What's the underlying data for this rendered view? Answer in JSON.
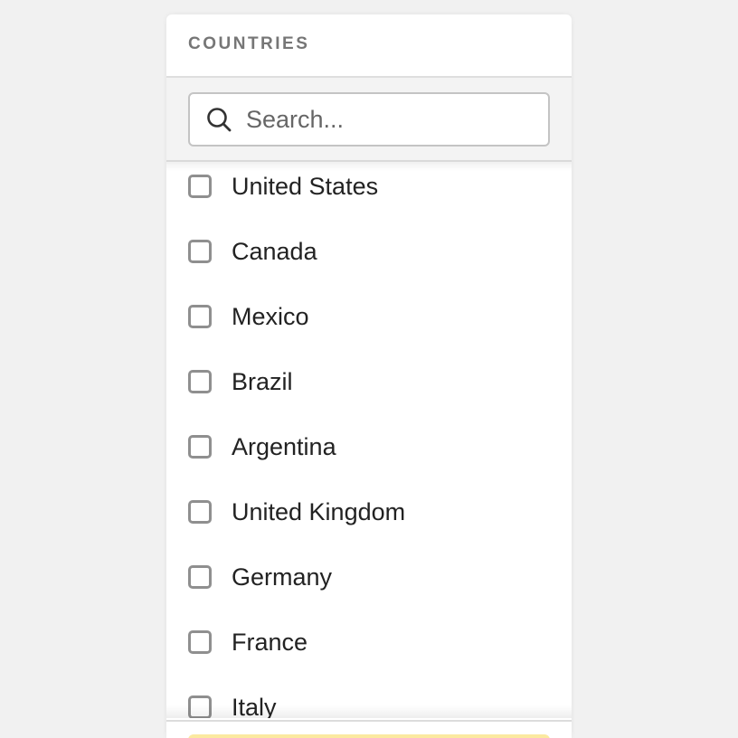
{
  "panel": {
    "title": "COUNTRIES"
  },
  "search": {
    "placeholder": "Search...",
    "value": "",
    "icon": "search-icon"
  },
  "countries": [
    {
      "label": "United States",
      "checked": false
    },
    {
      "label": "Canada",
      "checked": false
    },
    {
      "label": "Mexico",
      "checked": false
    },
    {
      "label": "Brazil",
      "checked": false
    },
    {
      "label": "Argentina",
      "checked": false
    },
    {
      "label": "United Kingdom",
      "checked": false
    },
    {
      "label": "Germany",
      "checked": false
    },
    {
      "label": "France",
      "checked": false
    },
    {
      "label": "Italy",
      "checked": false
    }
  ],
  "colors": {
    "background": "#f1f1f1",
    "panel": "#ffffff",
    "title": "#767676",
    "checkbox_border": "#8f8f8f",
    "footer_accent": "#fbe9a0"
  }
}
